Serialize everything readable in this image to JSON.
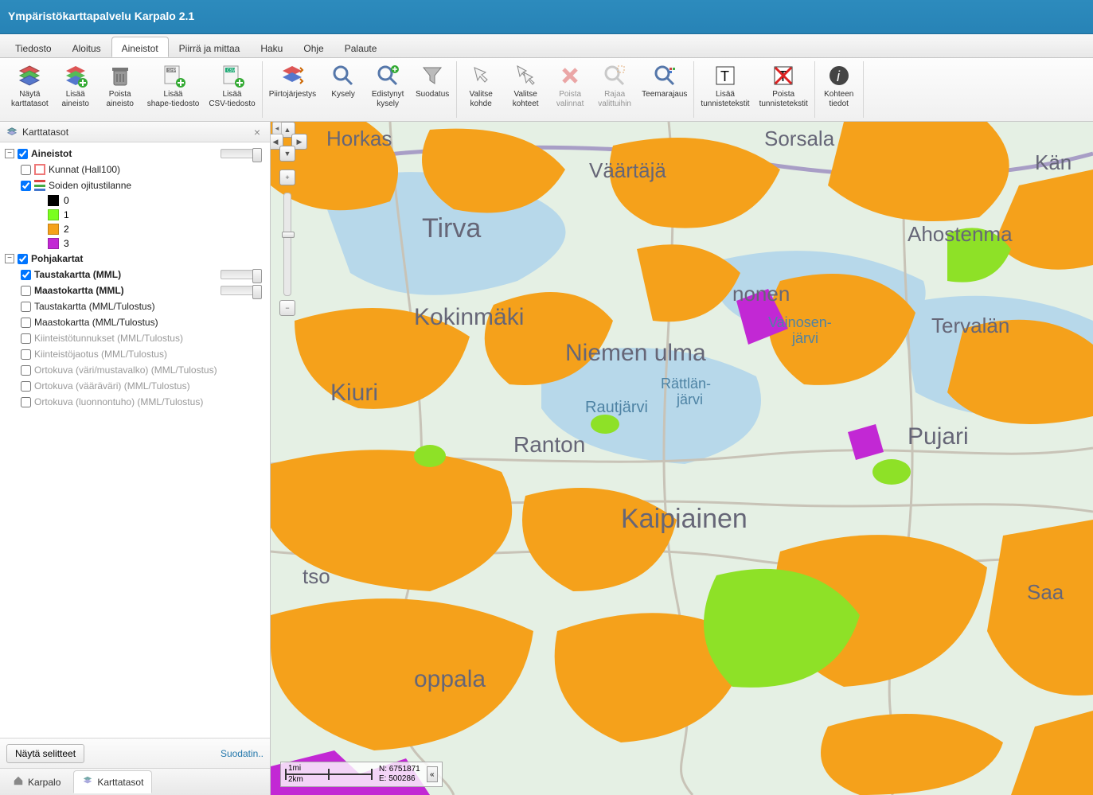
{
  "title": "Ympäristökarttapalvelu Karpalo 2.1",
  "menus": [
    "Tiedosto",
    "Aloitus",
    "Aineistot",
    "Piirrä ja mittaa",
    "Haku",
    "Ohje",
    "Palaute"
  ],
  "active_menu": 2,
  "ribbon": [
    {
      "items": [
        {
          "key": "show-layers",
          "label": "Näytä\nkarttatasot"
        },
        {
          "key": "add-dataset",
          "label": "Lisää\naineisto"
        },
        {
          "key": "del-dataset",
          "label": "Poista\naineisto"
        },
        {
          "key": "add-shp",
          "label": "Lisää\nshape-tiedosto"
        },
        {
          "key": "add-csv",
          "label": "Lisää\nCSV-tiedosto"
        }
      ]
    },
    {
      "items": [
        {
          "key": "draw-order",
          "label": "Piirtojärjestys"
        },
        {
          "key": "query",
          "label": "Kysely"
        },
        {
          "key": "adv-query",
          "label": "Edistynyt\nkysely"
        },
        {
          "key": "filter",
          "label": "Suodatus"
        }
      ]
    },
    {
      "items": [
        {
          "key": "select-obj",
          "label": "Valitse\nkohde"
        },
        {
          "key": "select-objs",
          "label": "Valitse\nkohteet"
        },
        {
          "key": "remove-sel",
          "label": "Poista\nvalinnat",
          "disabled": true
        },
        {
          "key": "crop-sel",
          "label": "Rajaa\nvalittuihin",
          "disabled": true
        },
        {
          "key": "theme",
          "label": "Teemarajaus"
        }
      ]
    },
    {
      "items": [
        {
          "key": "add-labels",
          "label": "Lisää\ntunnistetekstit"
        },
        {
          "key": "del-labels",
          "label": "Poista\ntunnistetekstit"
        }
      ]
    },
    {
      "items": [
        {
          "key": "obj-info",
          "label": "Kohteen\ntiedot"
        }
      ]
    }
  ],
  "panel": {
    "title": "Karttatasot",
    "footer_btn": "Näytä selitteet",
    "footer_link": "Suodatin..",
    "tabs": [
      {
        "key": "karpalo",
        "label": "Karpalo"
      },
      {
        "key": "karttatasot",
        "label": "Karttatasot"
      }
    ],
    "active_tab": 1
  },
  "tree": {
    "aineistot": {
      "label": "Aineistot",
      "checked": true,
      "children": [
        {
          "key": "kunnat",
          "label": "Kunnat (Hall100)",
          "checked": false
        },
        {
          "key": "soiden",
          "label": "Soiden ojitustilanne",
          "checked": true,
          "legend": [
            {
              "value": "0",
              "color": "#000000"
            },
            {
              "value": "1",
              "color": "#7AFF1E"
            },
            {
              "value": "2",
              "color": "#F5A11B"
            },
            {
              "value": "3",
              "color": "#C228D4"
            }
          ]
        }
      ]
    },
    "pohjakartat": {
      "label": "Pohjakartat",
      "checked": true,
      "children": [
        {
          "key": "tausta-mml",
          "label": "Taustakartta (MML)",
          "checked": true,
          "bold": true,
          "slider": true
        },
        {
          "key": "maasto-mml",
          "label": "Maastokartta (MML)",
          "checked": false,
          "bold": true,
          "slider": true
        },
        {
          "key": "tausta-tul",
          "label": "Taustakartta (MML/Tulostus)",
          "checked": false
        },
        {
          "key": "maasto-tul",
          "label": "Maastokartta (MML/Tulostus)",
          "checked": false
        },
        {
          "key": "kiint-tun",
          "label": "Kiinteistötunnukset (MML/Tulostus)",
          "checked": false,
          "dim": true
        },
        {
          "key": "kiint-jao",
          "label": "Kiinteistöjaotus (MML/Tulostus)",
          "checked": false,
          "dim": true
        },
        {
          "key": "orto-vm",
          "label": "Ortokuva (väri/mustavalko) (MML/Tulostus)",
          "checked": false,
          "dim": true
        },
        {
          "key": "orto-vv",
          "label": "Ortokuva (vääräväri) (MML/Tulostus)",
          "checked": false,
          "dim": true
        },
        {
          "key": "orto-lt",
          "label": "Ortokuva (luonnontuho) (MML/Tulostus)",
          "checked": false,
          "dim": true
        }
      ]
    }
  },
  "map": {
    "places": [
      "Horkas",
      "Sorsala",
      "Väärtäjä",
      "Kan",
      "Tirva",
      "Ahostenma",
      "Kokinmäki",
      "Niemen ulma",
      "nonen",
      "Vainosen-\njärvi",
      "Tervalan",
      "Kiuri",
      "Rautjärvi",
      "Rättlän-\njärvi",
      "Pujari",
      "Ranton",
      "Kaipiainen",
      "tso",
      "Saa",
      "oppala"
    ],
    "scale_top": "1mi",
    "scale_bottom": "2km",
    "coord_n": "N: 6751871",
    "coord_e": "E: 500286"
  }
}
